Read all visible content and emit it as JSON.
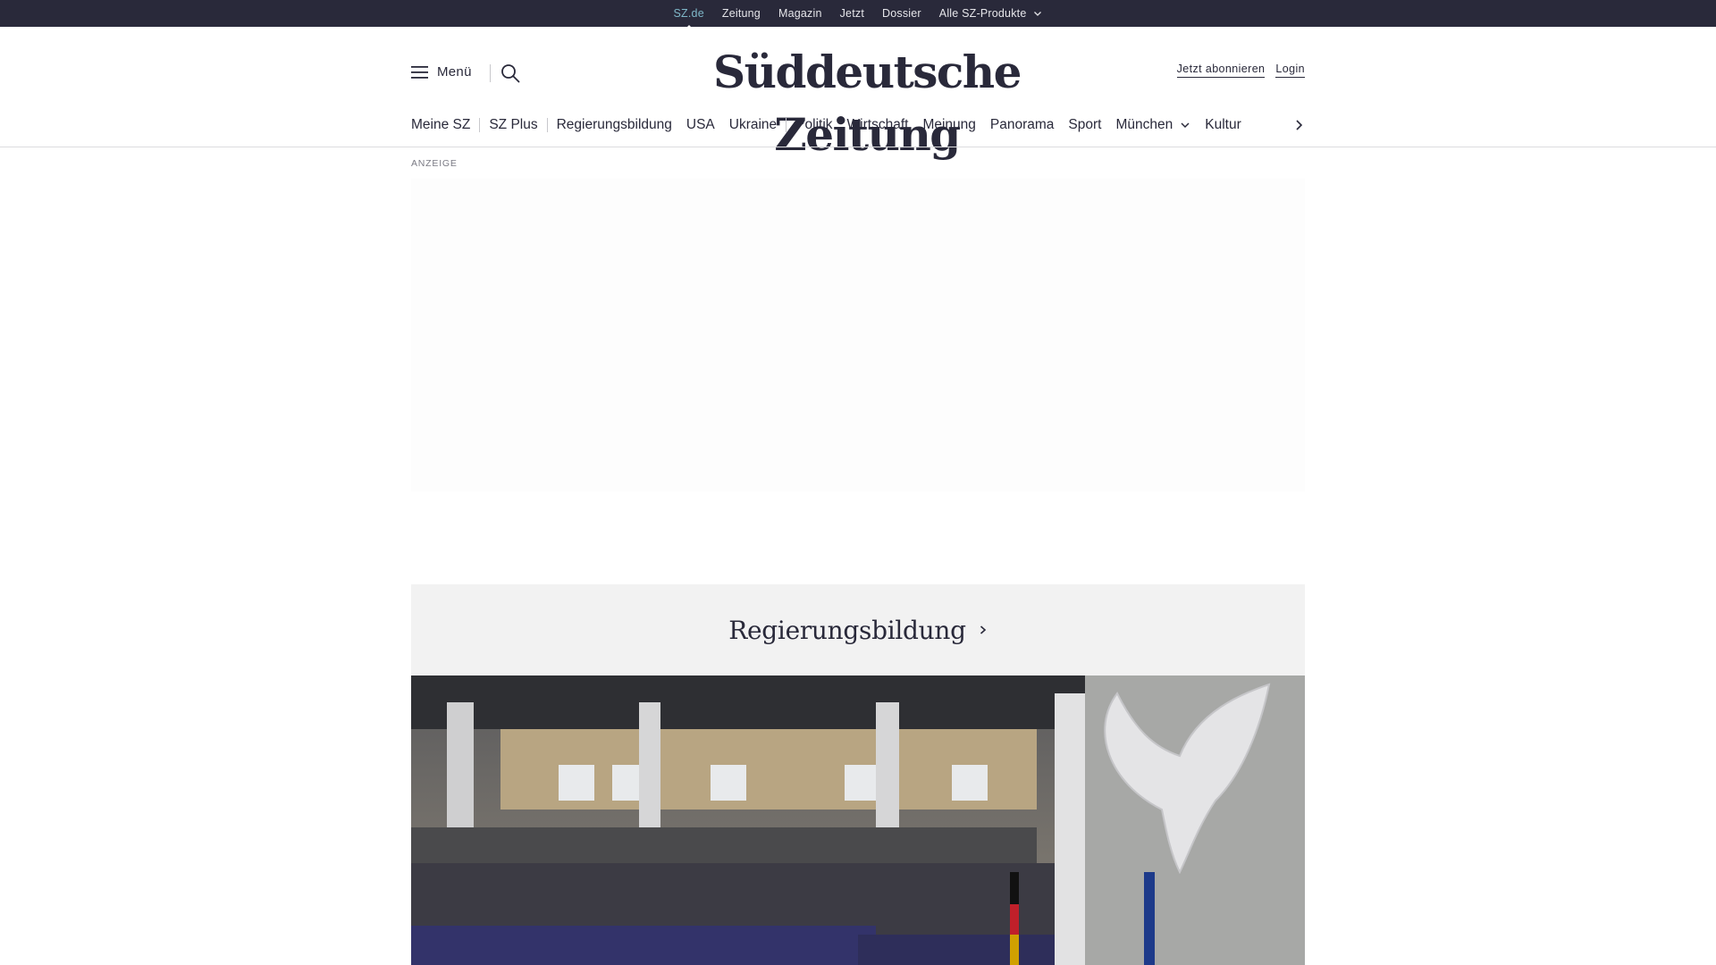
{
  "topbar": {
    "links": [
      {
        "label": "SZ.de",
        "active": true
      },
      {
        "label": "Zeitung"
      },
      {
        "label": "Magazin"
      },
      {
        "label": "Jetzt"
      },
      {
        "label": "Dossier"
      },
      {
        "label": "Alle SZ-Produkte",
        "has_dropdown": true
      }
    ]
  },
  "header": {
    "menu_label": "Menü",
    "logo_text": "Süddeutsche Zeitung",
    "subscribe_label": "Jetzt abonnieren",
    "login_label": "Login"
  },
  "ressort_nav": {
    "items": [
      {
        "label": "Meine SZ"
      },
      {
        "label": "SZ Plus"
      },
      {
        "label": "Regierungsbildung"
      },
      {
        "label": "USA"
      },
      {
        "label": "Ukraine"
      },
      {
        "label": "Politik"
      },
      {
        "label": "Wirtschaft"
      },
      {
        "label": "Meinung"
      },
      {
        "label": "Panorama"
      },
      {
        "label": "Sport"
      },
      {
        "label": "München",
        "has_dropdown": true
      },
      {
        "label": "Kultur"
      }
    ]
  },
  "ad": {
    "label": "ANZEIGE"
  },
  "topic": {
    "title": "Regierungsbildung"
  },
  "colors": {
    "topbar_bg": "#29293a",
    "active_link": "#7fb8c9",
    "text": "#29293a",
    "topic_bg": "#f2f2f2"
  }
}
